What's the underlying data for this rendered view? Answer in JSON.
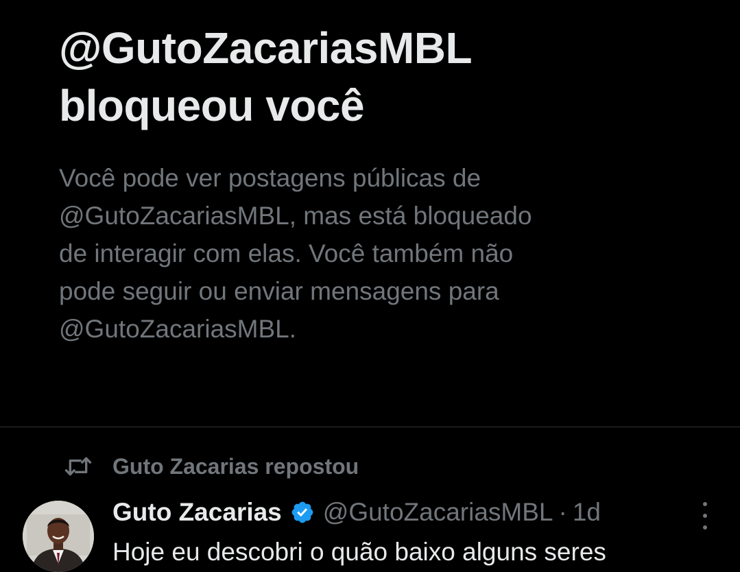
{
  "blocked": {
    "title_line1": "@GutoZacariasMBL",
    "title_line2": "bloqueou você",
    "description_lines": [
      "Você pode ver postagens públicas de",
      "@GutoZacariasMBL, mas está bloqueado",
      "de interagir com elas. Você também não",
      "pode seguir ou enviar mensagens para",
      "@GutoZacariasMBL."
    ]
  },
  "repost": {
    "icon": "repost-icon",
    "label": "Guto Zacarias repostou"
  },
  "tweet": {
    "avatar": "avatar",
    "author_name": "Guto Zacarias",
    "verified_icon": "verified-badge-icon",
    "handle": "@GutoZacariasMBL",
    "separator": "·",
    "time": "1d",
    "more_icon": "more-options-icon",
    "text": "Hoje eu descobri o quão baixo alguns seres"
  },
  "colors": {
    "background": "#000000",
    "primary_text": "#e7e9ea",
    "secondary_text": "#71767b",
    "divider": "#2f3336",
    "verified_blue": "#1d9bf0"
  }
}
